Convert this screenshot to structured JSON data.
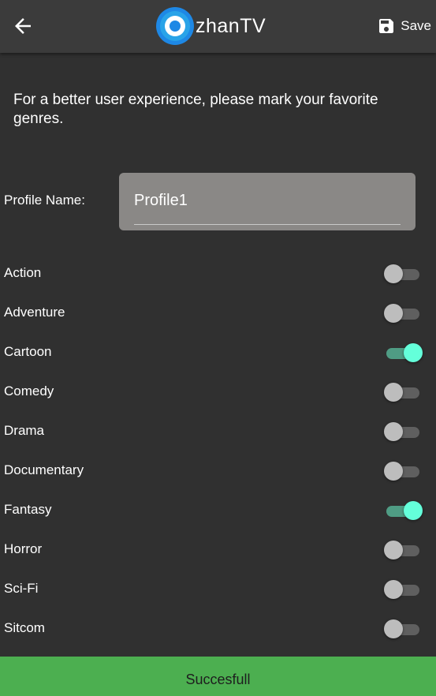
{
  "appbar": {
    "logo_text": "zhanTV",
    "save_label": "Save",
    "back_icon": "arrow-left-icon",
    "save_icon": "floppy-disk-icon",
    "logo_icon": "ozhantv-logo-icon",
    "logo_color": "#1e88e5"
  },
  "intro": {
    "text": "For a better user experience, please mark your favorite genres."
  },
  "profile": {
    "label": "Profile Name:",
    "value": "Profile1"
  },
  "genres": [
    {
      "label": "Action",
      "enabled": false
    },
    {
      "label": "Adventure",
      "enabled": false
    },
    {
      "label": "Cartoon",
      "enabled": true
    },
    {
      "label": "Comedy",
      "enabled": false
    },
    {
      "label": "Drama",
      "enabled": false
    },
    {
      "label": "Documentary",
      "enabled": false
    },
    {
      "label": "Fantasy",
      "enabled": true
    },
    {
      "label": "Horror",
      "enabled": false
    },
    {
      "label": "Sci-Fi",
      "enabled": false
    },
    {
      "label": "Sitcom",
      "enabled": false
    }
  ],
  "snackbar": {
    "message": "Succesfull",
    "color": "#4caf50"
  },
  "colors": {
    "background": "#303030",
    "appbar": "#3b3b3b",
    "toggle_on": "#64ffda",
    "toggle_off": "#bdbdbd",
    "field_background": "#8a8886"
  }
}
